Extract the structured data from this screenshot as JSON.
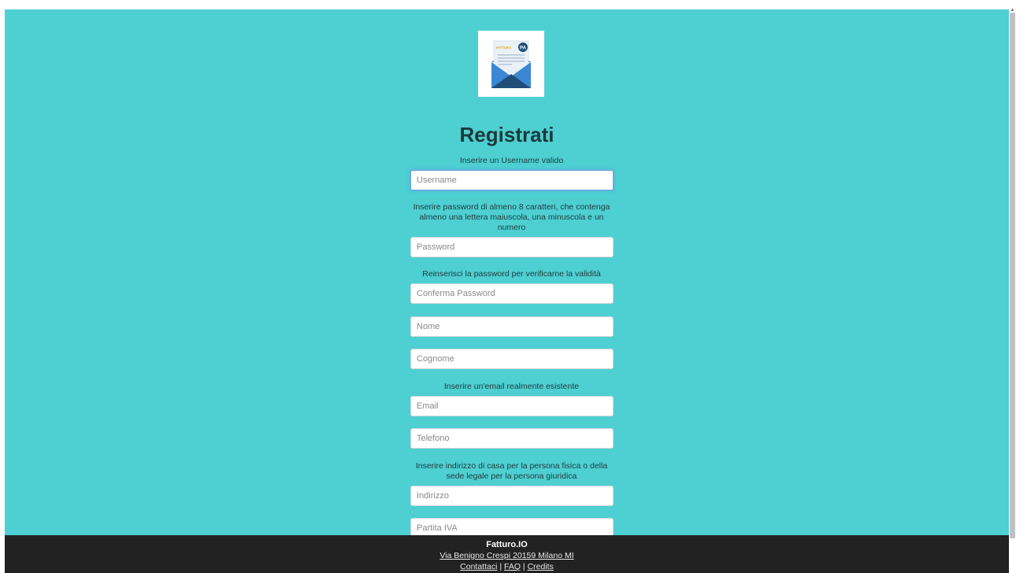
{
  "logo": {
    "badge_text": "FATTURA",
    "badge_initials": "PA"
  },
  "form": {
    "title": "Registrati",
    "username": {
      "hint": "Inserire un Username valido",
      "placeholder": "Username",
      "value": ""
    },
    "password": {
      "hint": "Inserire password di almeno 8 caratteri, che contenga almeno una lettera maiuscola, una minuscola e un numero",
      "placeholder": "Password",
      "value": ""
    },
    "confirm_password": {
      "hint": "Reinserisci la password per verificarne la validità",
      "placeholder": "Conferma Password",
      "value": ""
    },
    "nome": {
      "placeholder": "Nome",
      "value": ""
    },
    "cognome": {
      "placeholder": "Cognome",
      "value": ""
    },
    "email": {
      "hint": "Inserire un'email realmente esistente",
      "placeholder": "Email",
      "value": ""
    },
    "telefono": {
      "placeholder": "Telefono",
      "value": ""
    },
    "indirizzo": {
      "hint": "Inserire indirizzo di casa per la persona fisica o della sede legale per la persona giuridica",
      "placeholder": "Indirizzo",
      "value": ""
    },
    "partita_iva": {
      "placeholder": "Partita IVA",
      "value": ""
    }
  },
  "footer": {
    "brand": "Fatturo.IO",
    "address": "Via Benigno Crespi 20159 Milano MI",
    "links": [
      "Contattaci",
      "FAQ",
      "Credits"
    ],
    "separator": " | "
  },
  "colors": {
    "background": "#4ecfd2",
    "footer": "#222222",
    "focus": "#66a3e0"
  }
}
